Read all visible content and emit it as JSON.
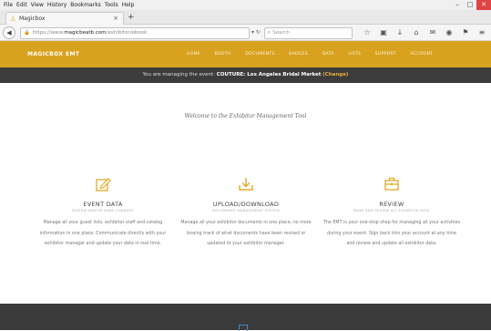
{
  "browser": {
    "menu": [
      "File",
      "Edit",
      "View",
      "History",
      "Bookmarks",
      "Tools",
      "Help"
    ],
    "window_controls": [
      "–",
      "□",
      "✕"
    ],
    "tab_title": "Magicbox",
    "tab_close": "×",
    "new_tab": "+",
    "url_prefix": "https://www.",
    "url_host": "magicbeatb.com",
    "url_path": "/exhibitor/ebook",
    "reload": "▾ ↻",
    "search_placeholder": "Search",
    "toolbar_icons": [
      "☆",
      "▣",
      "↓",
      "⌂",
      "✉",
      "◉",
      "⚑",
      "≡"
    ]
  },
  "site": {
    "brand": "MAGICBOX EMT",
    "nav": [
      "HOME",
      "BOOTH",
      "DOCUMENTS",
      "BADGES",
      "DATA",
      "LISTS",
      "SUPPORT",
      "ACCOUNT"
    ],
    "event_prefix": "You are managing the event:",
    "event_name": "COUTURE: Los Angeles Bridal Market",
    "event_change": "(Change)",
    "welcome": "Welcome to the Exhibitor Management Tool"
  },
  "features": [
    {
      "icon": "pencil-square-icon",
      "title": "EVENT DATA",
      "subtitle": "REVIEW AND/OR MAKE CHANGES",
      "description": "Manage all your guest lists, exhibitor staff and catalog information in one place. Communicate directly with your exhibitor manager and update your data in real time."
    },
    {
      "icon": "download-icon",
      "title": "UPLOAD/DOWNLOAD",
      "subtitle": "DOCUMENTS MANAGEMENT SYSTEM",
      "description": "Manage all your exhibitor documents in one place, no more loosing track of what documents have been revised or updated to your exhibitor manager."
    },
    {
      "icon": "briefcase-icon",
      "title": "REVIEW",
      "subtitle": "MAKE AND REVIEW ALL EXHIBITOR DATA",
      "description": "The EMT is your one-stop shop for managing all your activities during your event. Sign back into your account at any time and review and update all exhibitor data."
    }
  ],
  "colors": {
    "header": "#d8a21f",
    "event_bar": "#3c3c3c",
    "accent": "#e8b23a",
    "footer": "#3b3b3b"
  }
}
